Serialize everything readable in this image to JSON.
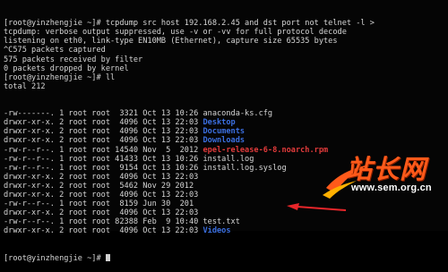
{
  "terminal": {
    "lines": [
      "[root@yinzhengjie ~]# tcpdump src host 192.168.2.45 and dst port not telnet -l >",
      "tcpdump: verbose output suppressed, use -v or -vv for full protocol decode",
      "listening on eth0, link-type EN10MB (Ethernet), capture size 65535 bytes",
      "^C575 packets captured",
      "575 packets received by filter",
      "0 packets dropped by kernel",
      "[root@yinzhengjie ~]# ll",
      "total 212"
    ],
    "listing": [
      {
        "meta": "-rw-------. 1 root root  3321 Oct 13 10:26 ",
        "name": "anaconda-ks.cfg",
        "kind": "file"
      },
      {
        "meta": "drwxr-xr-x. 2 root root  4096 Oct 13 22:03 ",
        "name": "Desktop",
        "kind": "dir"
      },
      {
        "meta": "drwxr-xr-x. 2 root root  4096 Oct 13 22:03 ",
        "name": "Documents",
        "kind": "dir"
      },
      {
        "meta": "drwxr-xr-x. 2 root root  4096 Oct 13 22:03 ",
        "name": "Downloads",
        "kind": "dir"
      },
      {
        "meta": "-rw-r--r--. 1 root root 14540 Nov  5  2012 ",
        "name": "epel-release-6-8.noarch.rpm",
        "kind": "rpm"
      },
      {
        "meta": "-rw-r--r--. 1 root root 41433 Oct 13 10:26 ",
        "name": "install.log",
        "kind": "file"
      },
      {
        "meta": "-rw-r--r--. 1 root root  9154 Oct 13 10:26 ",
        "name": "install.log.syslog",
        "kind": "file"
      },
      {
        "meta": "drwxr-xr-x. 2 root root  4096 Oct 13 22:03 ",
        "name": "",
        "kind": "dir"
      },
      {
        "meta": "drwxr-xr-x. 2 root root  5462 Nov 29 2012 ",
        "name": "",
        "kind": "dir"
      },
      {
        "meta": "drwxr-xr-x. 2 root root  4096 Oct 13 22:03 ",
        "name": "",
        "kind": "dir"
      },
      {
        "meta": "-rw-r--r--. 1 root root  8159 Jun 30  201",
        "name": "",
        "kind": "file"
      },
      {
        "meta": "drwxr-xr-x. 2 root root  4096 Oct 13 22:03 ",
        "name": "",
        "kind": "dir"
      },
      {
        "meta": "-rw-r--r--. 1 root root 82388 Feb  9 10:40 ",
        "name": "test.txt",
        "kind": "file"
      },
      {
        "meta": "drwxr-xr-x. 2 root root  4096 Oct 13 22:03 ",
        "name": "Videos",
        "kind": "dir"
      }
    ],
    "prompt": "[root@yinzhengjie ~]# "
  },
  "watermark": {
    "brand": "站长网",
    "url": "www.sem.org.cn",
    "color": "#ff5a1a"
  },
  "annotation": {
    "arrow_color": "#e8262a"
  }
}
